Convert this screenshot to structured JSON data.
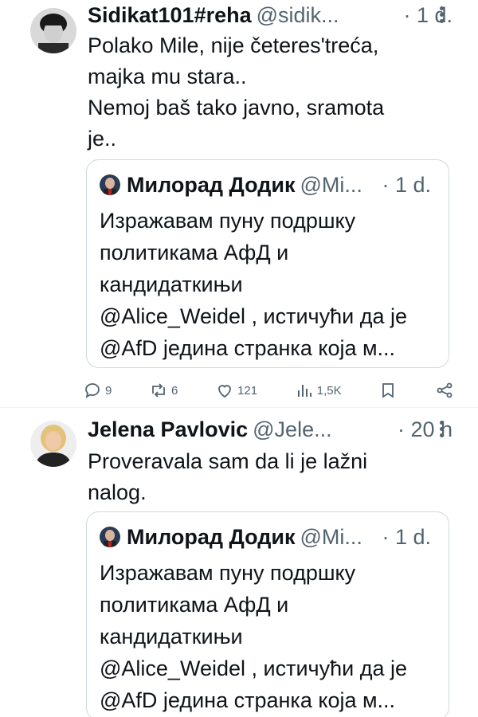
{
  "tweets": [
    {
      "display_name": "Sidikat101#reha",
      "handle": "@sidik...",
      "time": "· 1 d.",
      "text": "Polako Mile, nije četeres'treća,\nmajka mu stara..\nNemoj baš tako javno, sramota\nje..",
      "quote": {
        "display_name": "Милорад Додик",
        "handle": "@Mi...",
        "time": "· 1 d.",
        "text": "Изражавам пуну подршку\nполитикама АфД и\nкандидаткињи\n@Alice_Weidel , истичући да је\n@AfD једина странка која м..."
      },
      "actions": {
        "replies": "9",
        "reposts": "6",
        "likes": "121",
        "views": "1,5K"
      }
    },
    {
      "display_name": "Jelena Pavlovic",
      "handle": "@Jele...",
      "time": "· 20 h",
      "text": "Proveravala sam da li je lažni\nnalog.",
      "quote": {
        "display_name": "Милорад Додик",
        "handle": "@Mi...",
        "time": "· 1 d.",
        "text": "Изражавам пуну подршку\nполитикама АфД и\nкандидаткињи\n@Alice_Weidel , истичући да је\n@AfD једина странка која м..."
      }
    }
  ],
  "icons": {
    "reply": "reply-icon",
    "repost": "repost-icon",
    "like": "heart-icon",
    "views": "views-icon",
    "bookmark": "bookmark-icon",
    "share": "share-icon",
    "more": "more-icon"
  },
  "colors": {
    "text": "#0f1419",
    "secondary": "#536471",
    "border": "#cfd9de",
    "divider": "#eff3f4"
  }
}
